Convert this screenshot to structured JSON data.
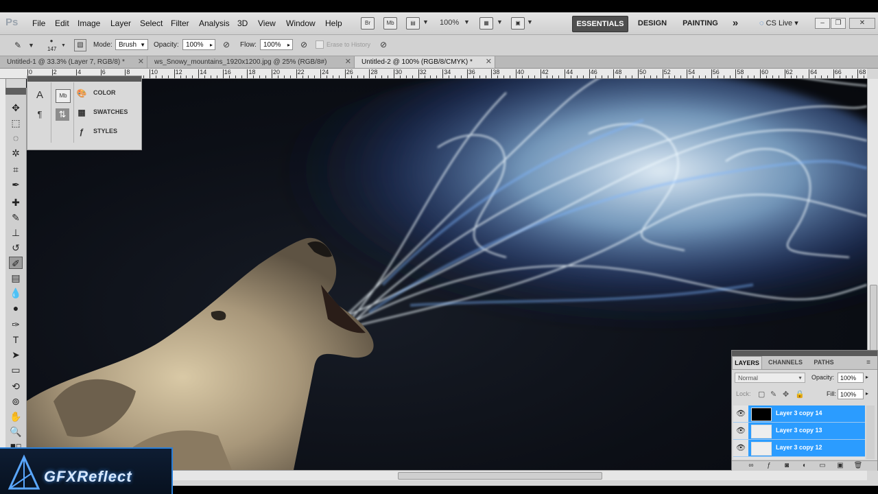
{
  "app": {
    "logo": "Ps"
  },
  "menu": [
    "File",
    "Edit",
    "Image",
    "Layer",
    "Select",
    "Filter",
    "Analysis",
    "3D",
    "View",
    "Window",
    "Help"
  ],
  "menubar": {
    "bridge_label": "Br",
    "minibridge_label": "Mb",
    "zoom": "100%",
    "workspaces": [
      "ESSENTIALS",
      "DESIGN",
      "PAINTING"
    ],
    "more": "»",
    "cs_live": "CS Live",
    "window_buttons": [
      "–",
      "❐",
      "✕"
    ]
  },
  "options": {
    "brush_size": "147",
    "mode_label": "Mode:",
    "mode_value": "Brush",
    "opacity_label": "Opacity:",
    "opacity_value": "100%",
    "flow_label": "Flow:",
    "flow_value": "100%",
    "erase_label": "Erase to History"
  },
  "doc_tabs": [
    {
      "label": "Untitled-1 @ 33.3% (Layer 7, RGB/8) *",
      "close": "✕"
    },
    {
      "label": "ws_Snowy_mountains_1920x1200.jpg @ 25% (RGB/8#)",
      "close": "✕"
    },
    {
      "label": "Untitled-2 @ 100% (RGB/8/CMYK) *",
      "close": "✕"
    }
  ],
  "ruler_labels": [
    "0",
    "2",
    "4",
    "6",
    "8",
    "10",
    "12",
    "14",
    "16",
    "18",
    "20",
    "22",
    "24",
    "26",
    "28",
    "30",
    "32",
    "34",
    "36",
    "38",
    "40",
    "42",
    "44",
    "46",
    "48",
    "50",
    "52",
    "54",
    "56",
    "58",
    "60",
    "62",
    "64",
    "66",
    "68"
  ],
  "panel": {
    "items": [
      "COLOR",
      "SWATCHES",
      "STYLES"
    ],
    "col1_icons": [
      "A",
      "¶"
    ],
    "col2_icons": [
      "Mb",
      "⇅"
    ]
  },
  "layers_panel": {
    "tabs": [
      "LAYERS",
      "CHANNELS",
      "PATHS"
    ],
    "blend_mode": "Normal",
    "opacity_label": "Opacity:",
    "opacity": "100%",
    "lock_label": "Lock:",
    "fill_label": "Fill:",
    "fill": "100%",
    "layers": [
      "Layer 3 copy 14",
      "Layer 3 copy 13",
      "Layer 3 copy 12"
    ]
  },
  "watermark": {
    "text": "GFXReflect"
  },
  "colors": {
    "selection": "#2b9cff",
    "canvas": "#0c0f16",
    "glow": "#9fd0ff"
  }
}
